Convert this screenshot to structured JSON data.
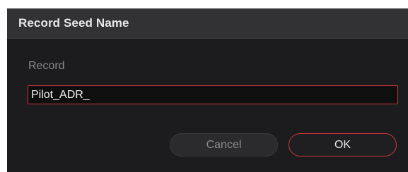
{
  "dialog": {
    "title": "Record Seed Name",
    "field": {
      "label": "Record",
      "value": "Pilot_ADR_"
    },
    "buttons": {
      "cancel": "Cancel",
      "ok": "OK"
    }
  },
  "colors": {
    "dialog_bg": "#1c1c1e",
    "titlebar_bg": "#323234",
    "accent_red": "#c9343a"
  }
}
